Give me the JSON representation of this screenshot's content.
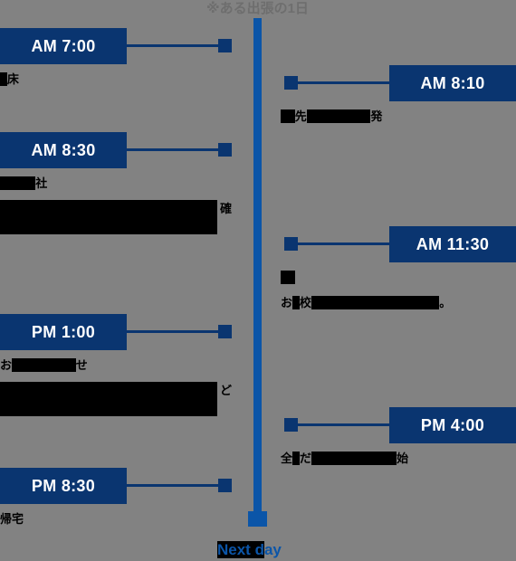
{
  "title": "※ある出張の1日",
  "colors": {
    "background": "#828282",
    "box_navy": "#0a3570",
    "spine_blue": "#0b55a8",
    "redaction": "#000000",
    "box_text": "#ffffff"
  },
  "footer": {
    "next_day_label": "Next day",
    "next_day_redacted_part": "Next d",
    "next_day_visible_part": "ay"
  },
  "events": [
    {
      "time": "AM 7:00",
      "side": "left",
      "lines": [
        {
          "redacted_prefix": "■",
          "visible": "床"
        }
      ]
    },
    {
      "time": "AM 8:10",
      "side": "right",
      "lines": [
        {
          "redacted_prefix": "■■",
          "visible": "先",
          "redacted_middle": "■■■■■■■■■",
          "visible_suffix": "発"
        }
      ]
    },
    {
      "time": "AM 8:30",
      "side": "left",
      "lines": [
        {
          "redacted_prefix": "■■■■■",
          "visible": "社"
        },
        {
          "block": true,
          "visible_suffix": "確"
        }
      ]
    },
    {
      "time": "AM 11:30",
      "side": "right",
      "lines": [
        {
          "redacted_prefix": "■■",
          "visible": ""
        },
        {
          "visible_prefix": "お",
          "redacted_prefix": "■",
          "visible": "校",
          "redacted_middle": "■■■■■■■■■■■■■■■■■■",
          "visible_suffix": "。"
        }
      ]
    },
    {
      "time": "PM 1:00",
      "side": "left",
      "lines": [
        {
          "visible_prefix": "お",
          "redacted_middle": "■■■■■■■■■",
          "visible_suffix": "せ"
        },
        {
          "block": true,
          "visible_suffix": "ど"
        }
      ]
    },
    {
      "time": "PM 4:00",
      "side": "right",
      "lines": [
        {
          "visible_prefix": "全",
          "redacted_prefix": "■",
          "visible": "だ",
          "redacted_middle": "■■■■■■■■■■■■",
          "visible_suffix": "始"
        }
      ]
    },
    {
      "time": "PM 8:30",
      "side": "left",
      "lines": [
        {
          "visible_prefix": "帰宅"
        }
      ]
    }
  ]
}
